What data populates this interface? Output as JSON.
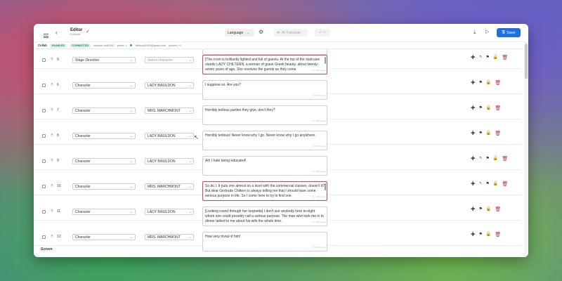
{
  "header": {
    "title": "Editor",
    "subtitle": "EurNacle",
    "language_label": "Language",
    "ai_translate_label": "AI Translate",
    "save_label": "Save"
  },
  "collab": {
    "label": "Collab",
    "enabled": "ENABLED",
    "connected": "CONNECTED",
    "session": "session: ed63457",
    "peers": "peers: 1",
    "user": "bfrloong1993@gmail.com",
    "user_note": "(owner) +0"
  },
  "rows": [
    {
      "num": "5",
      "type": "Stage Direction",
      "character": "Select character",
      "placeholder": true,
      "text": "[The room is brilliantly lighted and full of guests. At the top of the staircase stands LADY CHILTERN, a woman of grave Greek beauty, about twenty-seven years of age. She receives the guests as they come",
      "active": true,
      "counter": "0 / 100 words",
      "corner": true
    },
    {
      "num": "6",
      "type": "Character",
      "character": "LADY BASILDON",
      "placeholder": false,
      "text": "I suppose so. Are you?",
      "active": false,
      "counter": "0 / 100 words",
      "corner": false
    },
    {
      "num": "7",
      "type": "Character",
      "character": "MRS. MARCHMONT",
      "placeholder": false,
      "text": "Horribly tedious parties they give, don't they?",
      "active": false,
      "counter": "0 / 100 words",
      "corner": false
    },
    {
      "num": "8",
      "type": "Character",
      "character": "LADY BASILDON",
      "placeholder": false,
      "text": "Horribly tedious! Never know why I go. Never know why I go anywhere.",
      "active": false,
      "counter": "0 / 100 words",
      "corner": false
    },
    {
      "num": "9",
      "type": "Character",
      "character": "LADY BASILDON",
      "placeholder": false,
      "text": "Ah! I hate being educated!",
      "active": false,
      "counter": "0 / 100 words",
      "corner": true
    },
    {
      "num": "10",
      "type": "Character",
      "character": "MRS. MARCHMONT",
      "placeholder": false,
      "text": "So do I. It puts one almost on a level with the commercial classes, doesn't it? But dear Gertrude Chiltern is always telling me that I should have some serious purpose in life. So I come here to try to find one.",
      "active": true,
      "counter": "0 / 100 words",
      "corner": true
    },
    {
      "num": "11",
      "type": "Character",
      "character": "LADY BASILDON",
      "placeholder": false,
      "text": "[Looking round through her lorgnette] I don't see anybody here to-night whom one could possibly call a serious purpose. The man who took me in to dinner talked to me about his wife the whole time.",
      "active": false,
      "counter": "0 / 100 words",
      "corner": false
    },
    {
      "num": "12",
      "type": "Character",
      "character": "MRS. MARCHMONT",
      "placeholder": false,
      "text": "How very trivial of him!",
      "active": false,
      "counter": "0 / 100 words",
      "corner": false
    }
  ],
  "footer": {
    "screen_label": "Screen"
  },
  "colors": {
    "accent": "#1f6fe0",
    "badge_bg": "#dff3e5",
    "badge_text": "#2d8a4a",
    "trash": "#b03040"
  }
}
